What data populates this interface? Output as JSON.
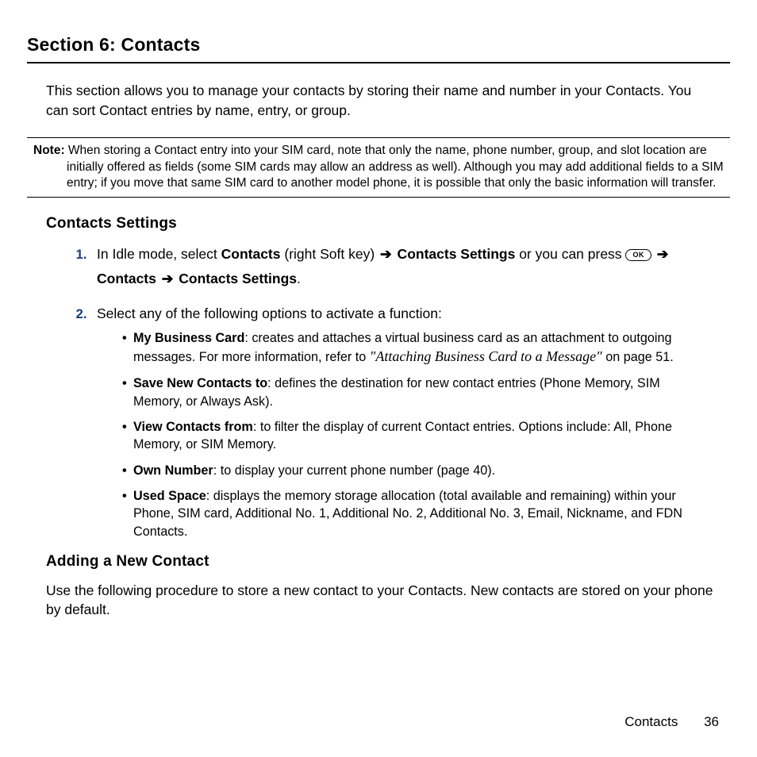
{
  "page": {
    "title": "Section 6: Contacts",
    "intro": "This section allows you to manage your contacts by storing their name and number in your Contacts. You can sort Contact entries by name, entry, or group.",
    "note_label": "Note:",
    "note_body": "When storing a Contact entry into your SIM card, note that only the name, phone number, group, and slot location are initially offered as fields (some SIM cards may allow an address as well). Although you may add additional fields to a SIM entry; if you move that same SIM card to another model phone, it is possible that only the basic information will transfer."
  },
  "settings": {
    "heading": "Contacts Settings",
    "step1": {
      "pre": "In Idle mode, select ",
      "contacts": "Contacts",
      "softkey": " (right Soft key) ",
      "arrow": "➔",
      "cs": " Contacts Settings",
      "mid": " or you can press ",
      "ok": "OK",
      "arrow2": " ➔ ",
      "contacts2": "Contacts",
      "arrow3": " ➔ ",
      "cs2": "Contacts Settings",
      "end": "."
    },
    "step2_intro": "Select any of the following options to activate a function:",
    "bullets": {
      "b1_label": "My Business Card",
      "b1_text": ": creates and attaches a virtual business card as an attachment to outgoing messages. For more information, refer to ",
      "b1_xref": "\"Attaching Business Card to a Message\"",
      "b1_tail": "  on page 51.",
      "b2_label": "Save New Contacts to",
      "b2_text": ": defines the destination for new contact entries (Phone Memory, SIM Memory, or Always Ask).",
      "b3_label": "View Contacts from",
      "b3_text": ": to filter the display of current Contact entries. Options include: All, Phone Memory, or SIM Memory.",
      "b4_label": "Own Number",
      "b4_text": ": to display your current phone number (page 40).",
      "b5_label": "Used Space",
      "b5_text": ": displays the memory storage allocation (total available and remaining) within your Phone, SIM card, Additional No. 1, Additional No. 2, Additional No. 3, Email, Nickname, and FDN Contacts."
    }
  },
  "adding": {
    "heading": "Adding a New Contact",
    "intro": "Use the following procedure to store a new contact to your Contacts. New contacts are stored on your phone by default."
  },
  "footer": {
    "label": "Contacts",
    "page": "36"
  }
}
